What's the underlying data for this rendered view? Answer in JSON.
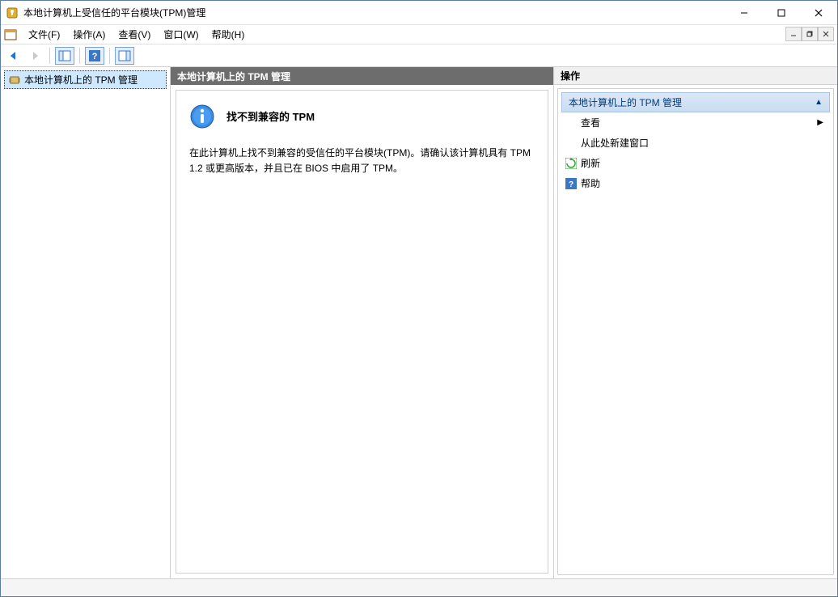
{
  "window": {
    "title": "本地计算机上受信任的平台模块(TPM)管理"
  },
  "menu": {
    "file": "文件(F)",
    "action": "操作(A)",
    "view": "查看(V)",
    "window": "窗口(W)",
    "help": "帮助(H)"
  },
  "tree": {
    "root": "本地计算机上的 TPM 管理"
  },
  "center": {
    "header": "本地计算机上的 TPM 管理",
    "message_title": "找不到兼容的 TPM",
    "message_body": "在此计算机上找不到兼容的受信任的平台模块(TPM)。请确认该计算机具有 TPM 1.2 或更高版本，并且已在 BIOS 中启用了 TPM。"
  },
  "actions": {
    "header": "操作",
    "section": "本地计算机上的 TPM 管理",
    "view": "查看",
    "new_window": "从此处新建窗口",
    "refresh": "刷新",
    "help": "帮助"
  }
}
